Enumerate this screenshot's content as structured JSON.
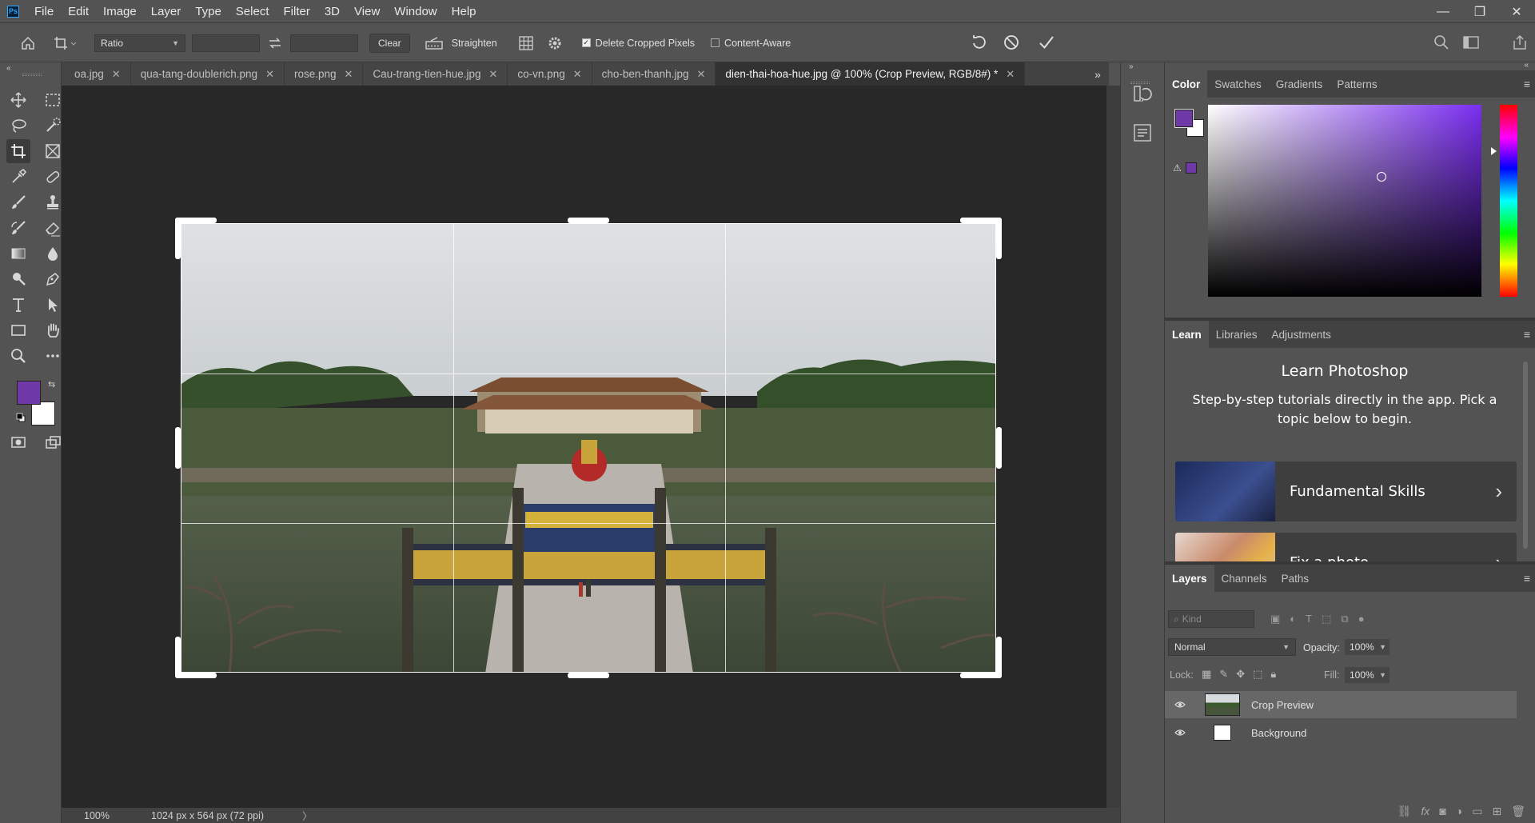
{
  "app": {
    "logo": "Ps",
    "window_buttons": [
      "—",
      "❐",
      "✕"
    ]
  },
  "menu": [
    "File",
    "Edit",
    "Image",
    "Layer",
    "Type",
    "Select",
    "Filter",
    "3D",
    "View",
    "Window",
    "Help"
  ],
  "options": {
    "ratio_label": "Ratio",
    "width_value": "",
    "height_value": "",
    "clear_label": "Clear",
    "straighten_label": "Straighten",
    "delete_cropped_label": "Delete Cropped Pixels",
    "delete_cropped_checked": true,
    "content_aware_label": "Content-Aware",
    "content_aware_checked": false
  },
  "tabs": [
    {
      "label": "oa.jpg"
    },
    {
      "label": "qua-tang-doublerich.png"
    },
    {
      "label": "rose.png"
    },
    {
      "label": "Cau-trang-tien-hue.jpg"
    },
    {
      "label": "co-vn.png"
    },
    {
      "label": "cho-ben-thanh.jpg"
    },
    {
      "label": "dien-thai-hoa-hue.jpg @ 100% (Crop Preview, RGB/8#) *",
      "active": true
    }
  ],
  "tab_close_glyph": "✕",
  "status": {
    "zoom": "100%",
    "doc_info": "1024 px x 564 px (72 ppi)",
    "arrow": "〉"
  },
  "colors": {
    "foreground": "#6f3aa8",
    "background": "#ffffff"
  },
  "color_panel": {
    "tabs": [
      "Color",
      "Swatches",
      "Gradients",
      "Patterns"
    ]
  },
  "learn_panel": {
    "tabs": [
      "Learn",
      "Libraries",
      "Adjustments"
    ],
    "title": "Learn Photoshop",
    "description": "Step-by-step tutorials directly in the app. Pick a topic below to begin.",
    "cards": [
      {
        "title": "Fundamental Skills"
      },
      {
        "title": "Fix a photo"
      }
    ]
  },
  "layers_panel": {
    "tabs": [
      "Layers",
      "Channels",
      "Paths"
    ],
    "filter_placeholder": "Kind",
    "blend_mode": "Normal",
    "opacity_label": "Opacity:",
    "opacity_value": "100%",
    "lock_label": "Lock:",
    "fill_label": "Fill:",
    "fill_value": "100%",
    "layers": [
      {
        "name": "Crop Preview",
        "selected": true
      },
      {
        "name": "Background",
        "selected": false
      }
    ]
  }
}
